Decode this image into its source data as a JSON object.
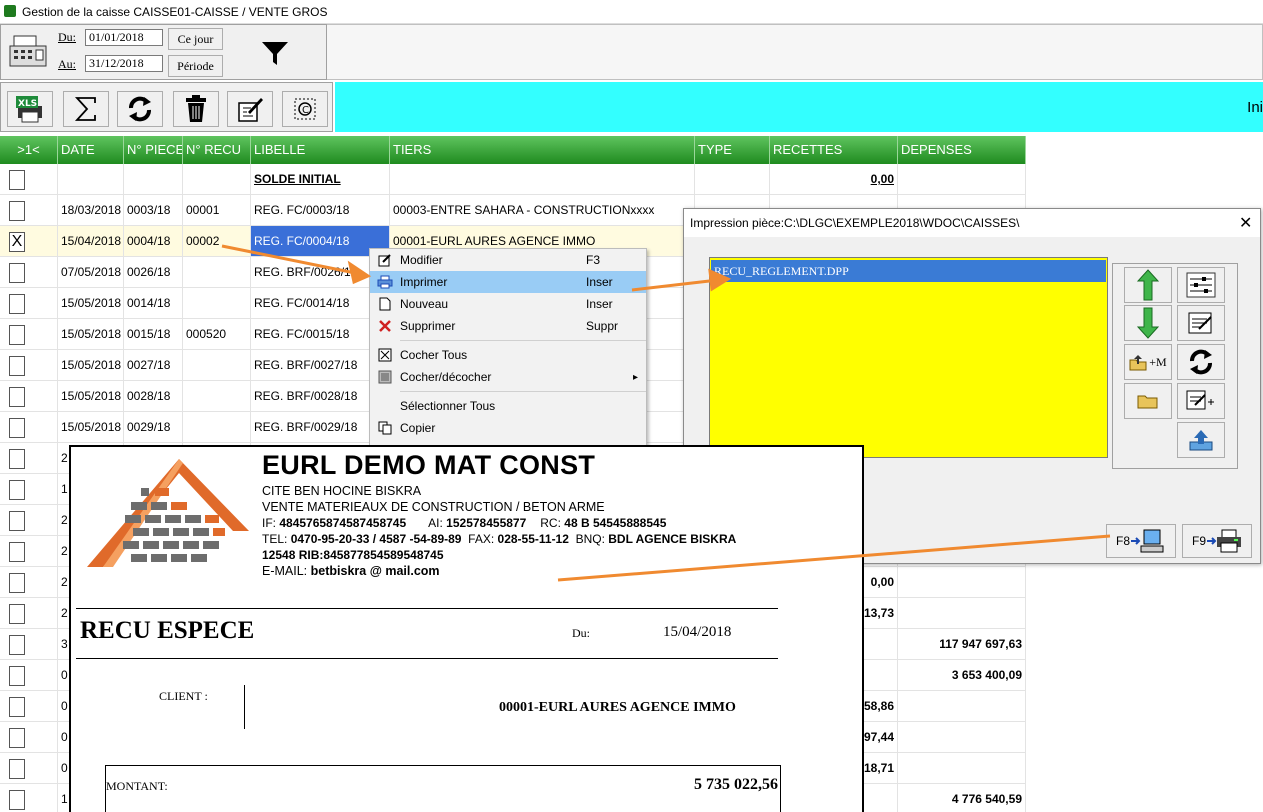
{
  "window": {
    "title": "Gestion de la caisse CAISSE01-CAISSE / VENTE GROS"
  },
  "filter": {
    "du_label": "Du:",
    "au_label": "Au:",
    "du_value": "01/01/2018",
    "au_value": "31/12/2018",
    "ce_jour_label": "Ce jour",
    "periode_label": "Période"
  },
  "banner": {
    "text": "Ini"
  },
  "toolbar": {
    "icons": [
      "xls-print-icon",
      "sigma-icon",
      "refresh-icon",
      "trash-icon",
      "edit-icon",
      "capture-icon"
    ]
  },
  "grid": {
    "headers": [
      ">1<",
      "DATE",
      "N° PIECE",
      "N° RECU",
      "LIBELLE",
      "TIERS",
      "TYPE",
      "RECETTES",
      "DEPENSES"
    ],
    "rows": [
      {
        "check": "",
        "date": "",
        "piece": "",
        "recu": "",
        "libelle": "SOLDE INITIAL",
        "tiers": "",
        "type": "",
        "recettes": "0,00",
        "depenses": ""
      },
      {
        "check": "",
        "date": "18/03/2018",
        "piece": "0003/18",
        "recu": "00001",
        "libelle": "REG. FC/0003/18",
        "tiers": "00003-ENTRE SAHARA - CONSTRUCTIONxxxx",
        "type": "",
        "recettes": "",
        "depenses": ""
      },
      {
        "check": "X",
        "date": "15/04/2018",
        "piece": "0004/18",
        "recu": "00002",
        "libelle": "REG. FC/0004/18",
        "tiers": "00001-EURL AURES AGENCE IMMO",
        "type": "",
        "recettes": "",
        "depenses": ""
      },
      {
        "check": "",
        "date": "07/05/2018",
        "piece": "0026/18",
        "recu": "",
        "libelle": "REG. BRF/0026/18",
        "tiers": "",
        "type": "",
        "recettes": "",
        "depenses": ""
      },
      {
        "check": "",
        "date": "15/05/2018",
        "piece": "0014/18",
        "recu": "",
        "libelle": "REG. FC/0014/18",
        "tiers": "",
        "type": "",
        "recettes": "",
        "depenses": ""
      },
      {
        "check": "",
        "date": "15/05/2018",
        "piece": "0015/18",
        "recu": "000520",
        "libelle": "REG. FC/0015/18",
        "tiers": "",
        "type": "",
        "recettes": "",
        "depenses": ""
      },
      {
        "check": "",
        "date": "15/05/2018",
        "piece": "0027/18",
        "recu": "",
        "libelle": "REG. BRF/0027/18",
        "tiers": "",
        "type": "",
        "recettes": "",
        "depenses": ""
      },
      {
        "check": "",
        "date": "15/05/2018",
        "piece": "0028/18",
        "recu": "",
        "libelle": "REG. BRF/0028/18",
        "tiers": "",
        "type": "",
        "recettes": "",
        "depenses": ""
      },
      {
        "check": "",
        "date": "15/05/2018",
        "piece": "0029/18",
        "recu": "",
        "libelle": "REG. BRF/0029/18",
        "tiers": "",
        "type": "",
        "recettes": "",
        "depenses": ""
      },
      {
        "check": "",
        "date": "2",
        "piece": "",
        "recu": "",
        "libelle": "",
        "tiers": "",
        "type": "",
        "recettes": "",
        "depenses": ""
      },
      {
        "check": "",
        "date": "1",
        "piece": "",
        "recu": "",
        "libelle": "",
        "tiers": "",
        "type": "",
        "recettes": "",
        "depenses": ""
      },
      {
        "check": "",
        "date": "2",
        "piece": "",
        "recu": "",
        "libelle": "",
        "tiers": "",
        "type": "",
        "recettes": "",
        "depenses": ""
      },
      {
        "check": "",
        "date": "2",
        "piece": "",
        "recu": "",
        "libelle": "",
        "tiers": "",
        "type": "",
        "recettes": "",
        "depenses": ""
      },
      {
        "check": "",
        "date": "2",
        "piece": "",
        "recu": "",
        "libelle": "",
        "tiers": "",
        "type": "",
        "recettes": "0,00",
        "depenses": ""
      },
      {
        "check": "",
        "date": "2",
        "piece": "",
        "recu": "",
        "libelle": "",
        "tiers": "",
        "type": "",
        "recettes": "13,73",
        "depenses": ""
      },
      {
        "check": "",
        "date": "3",
        "piece": "",
        "recu": "",
        "libelle": "",
        "tiers": "",
        "type": "",
        "recettes": "",
        "depenses": "117 947 697,63"
      },
      {
        "check": "",
        "date": "0",
        "piece": "",
        "recu": "",
        "libelle": "",
        "tiers": "",
        "type": "",
        "recettes": "",
        "depenses": "3 653 400,09"
      },
      {
        "check": "",
        "date": "0",
        "piece": "",
        "recu": "",
        "libelle": "",
        "tiers": "",
        "type": "",
        "recettes": "58,86",
        "depenses": ""
      },
      {
        "check": "",
        "date": "0",
        "piece": "",
        "recu": "",
        "libelle": "",
        "tiers": "",
        "type": "",
        "recettes": "97,44",
        "depenses": ""
      },
      {
        "check": "",
        "date": "0",
        "piece": "",
        "recu": "",
        "libelle": "",
        "tiers": "",
        "type": "",
        "recettes": "18,71",
        "depenses": ""
      },
      {
        "check": "",
        "date": "1",
        "piece": "",
        "recu": "",
        "libelle": "",
        "tiers": "",
        "type": "",
        "recettes": "",
        "depenses": "4 776 540,59"
      }
    ]
  },
  "context_menu": {
    "items": [
      {
        "label": "Modifier",
        "shortcut": "F3",
        "icon": "edit-doc-icon"
      },
      {
        "label": "Imprimer",
        "shortcut": "Inser",
        "icon": "printer-icon"
      },
      {
        "label": "Nouveau",
        "shortcut": "Inser",
        "icon": "new-doc-icon"
      },
      {
        "label": "Supprimer",
        "shortcut": "Suppr",
        "icon": "delete-x-icon"
      },
      {
        "label": "Cocher Tous",
        "shortcut": "",
        "icon": "checkbox-x-icon"
      },
      {
        "label": "Cocher/décocher",
        "shortcut": "",
        "icon": "toggle-check-icon"
      },
      {
        "label": "Sélectionner Tous",
        "shortcut": "",
        "icon": ""
      },
      {
        "label": "Copier",
        "shortcut": "",
        "icon": "copy-icon"
      }
    ]
  },
  "print_dialog": {
    "title": "Impression pièce:C:\\DLGC\\EXEMPLE2018\\WDOC\\CAISSES\\",
    "file": "RECU_REGLEMENT.DPP",
    "plus_m": "+M",
    "f8": "F8",
    "f9": "F9",
    "colors": {
      "list_bg": "#ffff00",
      "selected": "#3a7bd5"
    }
  },
  "receipt": {
    "company": "EURL DEMO MAT CONST",
    "address": "CITE BEN HOCINE BISKRA",
    "activity": "VENTE MATERIEAUX DE CONSTRUCTION  / BETON ARME",
    "if_label": "IF:",
    "if_value": "4845765874587458745",
    "ai_label": "AI:",
    "ai_value": "152578455877",
    "rc_label": "RC:",
    "rc_value": "48 B 54545888545",
    "tel_label": "TEL:",
    "tel_value": "0470-95-20-33 / 4587 -54-89-89",
    "fax_label": "FAX:",
    "fax_value": "028-55-11-12",
    "bnq_label": "BNQ:",
    "bnq_value": "BDL AGENCE BISKRA",
    "rib_prefix": "12548",
    "rib_label": "RIB:",
    "rib_value": "845877854589548745",
    "email_label": "E-MAIL:",
    "email_value": "betbiskra @ mail.com",
    "doc_title": "RECU ESPECE",
    "du_label": "Du:",
    "date": "15/04/2018",
    "client_label": "CLIENT :",
    "client": "00001-EURL AURES AGENCE IMMO",
    "montant_label": "MONTANT:",
    "montant": "5 735 022,56"
  }
}
